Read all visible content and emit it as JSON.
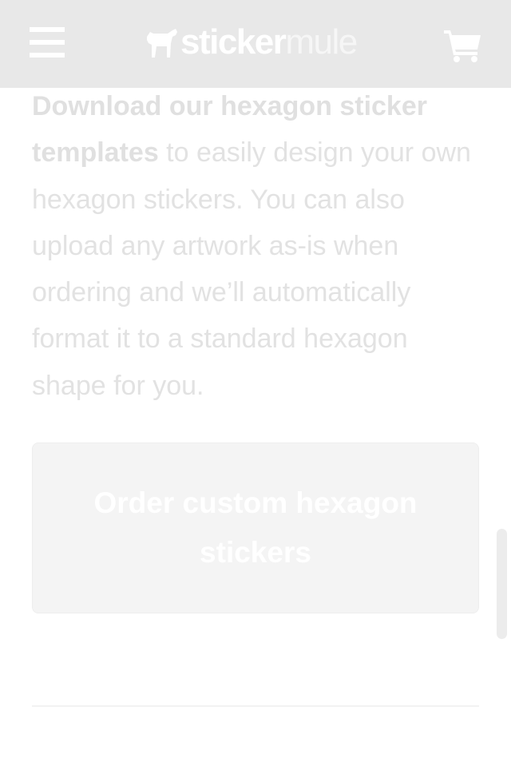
{
  "header": {
    "logo": {
      "part1": "sticker",
      "part2": "mule"
    },
    "icons": {
      "menu": "hamburger-menu-icon",
      "cart": "shopping-cart-icon",
      "logo_mark": "mule-icon"
    }
  },
  "main": {
    "paragraph": {
      "link_text": "Download our hexagon sticker templates",
      "body_text": " to easily design your own hexagon stickers. You can also upload any artwork as-is when ordering and we’ll automatically format it to a standard hexagon shape for you."
    },
    "cta_button_label": "Order custom hexagon stickers"
  },
  "colors": {
    "header_bg": "#e8e8e8",
    "text": "#e2e2e2",
    "button_bg": "#f4f4f4"
  }
}
